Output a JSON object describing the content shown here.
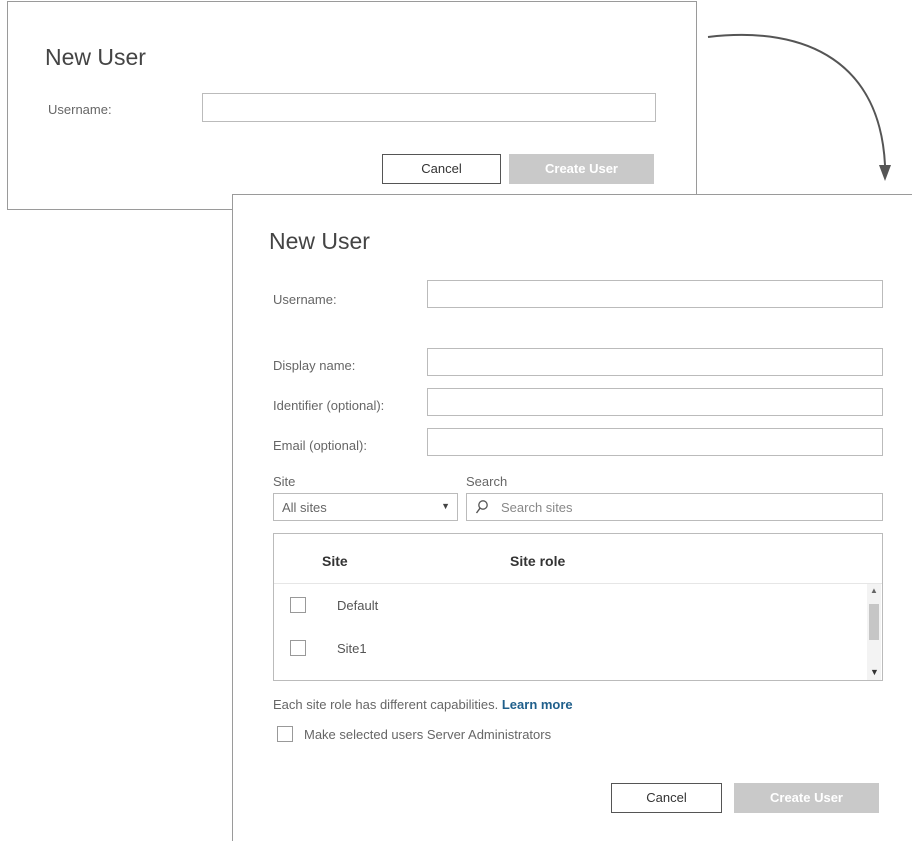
{
  "small_dialog": {
    "title": "New User",
    "username_label": "Username:",
    "username_value": "",
    "cancel_label": "Cancel",
    "create_label": "Create User"
  },
  "large_dialog": {
    "title": "New User",
    "fields": {
      "username_label": "Username:",
      "display_name_label": "Display name:",
      "identifier_label": "Identifier (optional):",
      "email_label": "Email (optional):"
    },
    "site_label": "Site",
    "site_select_value": "All sites",
    "search_label": "Search",
    "search_placeholder": "Search sites",
    "table": {
      "columns": [
        "Site",
        "Site role"
      ],
      "rows": [
        {
          "site": "Default",
          "checked": false
        },
        {
          "site": "Site1",
          "checked": false
        }
      ]
    },
    "note_text": "Each site role has different capabilities.",
    "learn_more": "Learn more",
    "admin_checkbox_label": "Make selected users Server Administrators",
    "cancel_label": "Cancel",
    "create_label": "Create User"
  },
  "colors": {
    "link": "#1f5f8b",
    "primary_disabled": "#c9c9c9",
    "border": "#bbbbbb"
  }
}
